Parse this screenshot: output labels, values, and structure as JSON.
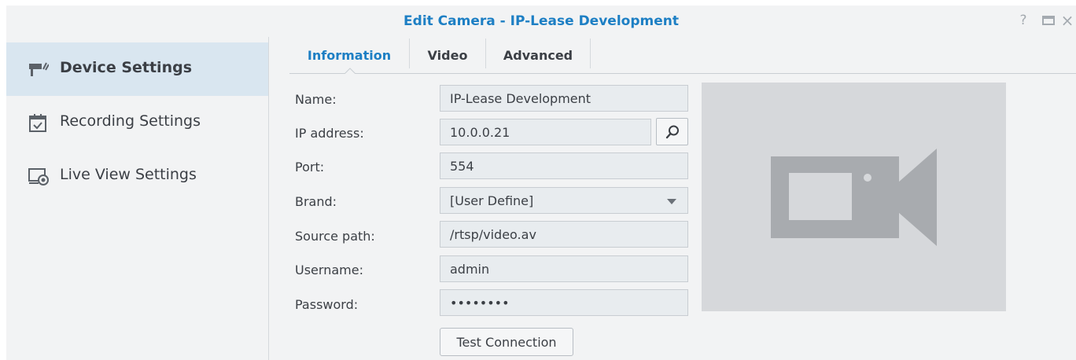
{
  "window": {
    "title": "Edit Camera - IP-Lease Development",
    "controls": {
      "help": "?",
      "minimize": "minimize",
      "close": "×"
    }
  },
  "sidebar": {
    "items": [
      {
        "label": "Device Settings",
        "icon": "camera-icon",
        "active": true
      },
      {
        "label": "Recording Settings",
        "icon": "calendar-icon",
        "active": false
      },
      {
        "label": "Live View Settings",
        "icon": "monitor-icon",
        "active": false
      }
    ]
  },
  "tabs": [
    {
      "label": "Information",
      "active": true
    },
    {
      "label": "Video",
      "active": false
    },
    {
      "label": "Advanced",
      "active": false
    }
  ],
  "form": {
    "name": {
      "label": "Name:",
      "value": "IP-Lease Development"
    },
    "ip": {
      "label": "IP address:",
      "value": "10.0.0.21"
    },
    "port": {
      "label": "Port:",
      "value": "554"
    },
    "brand": {
      "label": "Brand:",
      "value": "[User Define]"
    },
    "source_path": {
      "label": "Source path:",
      "value": "/rtsp/video.av"
    },
    "username": {
      "label": "Username:",
      "value": "admin"
    },
    "password": {
      "label": "Password:",
      "value": "••••••••"
    },
    "test_button": "Test Connection"
  },
  "colors": {
    "accent": "#1d7fc4",
    "sidebar_active": "#d9e6f0",
    "preview_bg": "#d6d8db",
    "preview_icon": "#a8abaf"
  }
}
